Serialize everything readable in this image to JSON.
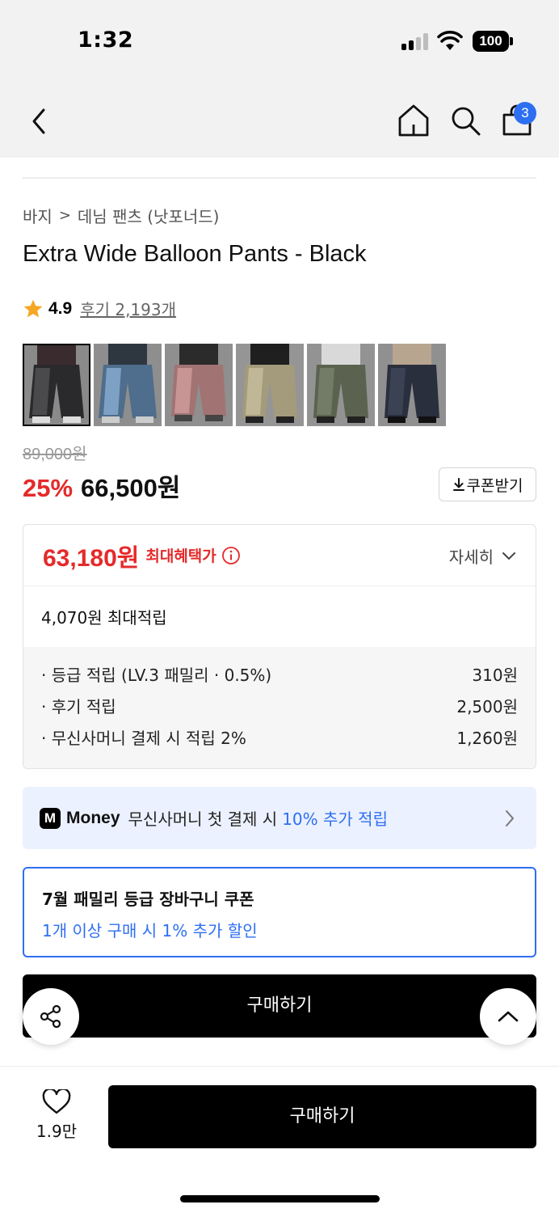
{
  "status_bar": {
    "time": "1:32",
    "battery": "100"
  },
  "header": {
    "cart_count": "3"
  },
  "breadcrumb": {
    "category": "바지",
    "separator": ">",
    "subcategory": "데님 팬츠 (낫포너드)"
  },
  "product": {
    "title": "Extra Wide Balloon Pants - Black",
    "rating": "4.9",
    "review_label": "후기 2,193개",
    "thumbnails": [
      "black-wash",
      "blue-wash",
      "pink-wash",
      "beige",
      "olive",
      "navy"
    ],
    "original_price": "89,000원",
    "discount": "25%",
    "price": "66,500원",
    "coupon_button": "쿠폰받기"
  },
  "benefits": {
    "max_benefit_price": "63,180원",
    "max_benefit_label": "최대혜택가",
    "detail_toggle": "자세히",
    "max_points": "4,070원 최대적립",
    "items": [
      {
        "label": "· 등급 적립 (LV.3 패밀리 · 0.5%)",
        "value": "310원"
      },
      {
        "label": "· 후기 적립",
        "value": "2,500원"
      },
      {
        "label": "· 무신사머니 결제 시 적립 2%",
        "value": "1,260원"
      }
    ]
  },
  "money_banner": {
    "logo": "M",
    "brand": "Money",
    "text": "무신사머니 첫 결제 시",
    "highlight": "10% 추가 적립"
  },
  "family_coupon": {
    "title": "7월 패밀리 등급 장바구니 쿠폰",
    "desc": "1개 이상 구매 시 1% 추가 할인"
  },
  "actions": {
    "buy_inline": "구매하기",
    "buy_main": "구매하기",
    "like_count": "1.9만"
  },
  "colors": {
    "accent_red": "#e52a2a",
    "accent_blue": "#2e6ff2",
    "star": "#f5a623"
  }
}
